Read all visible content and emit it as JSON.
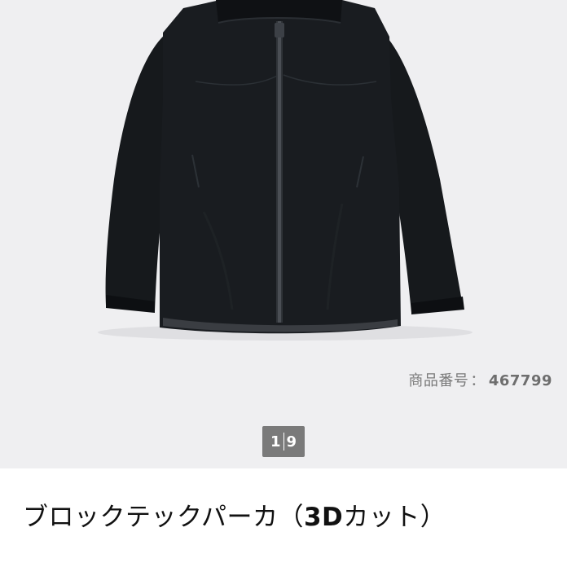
{
  "product": {
    "code_label": "商品番号",
    "code_separator": "：",
    "code_value": "467799",
    "title_main": "ブロックテックパーカ",
    "title_open": "（",
    "title_bold": "3D",
    "title_rest": "カット）"
  },
  "pager": {
    "current": "1",
    "total": "9"
  },
  "colors": {
    "image_background": "#efeff1",
    "jacket": "#16191c",
    "pager_background": "#7a7a7a",
    "code_text": "#7a7a7a"
  },
  "icons": {
    "product_image": "black-hooded-jacket"
  }
}
